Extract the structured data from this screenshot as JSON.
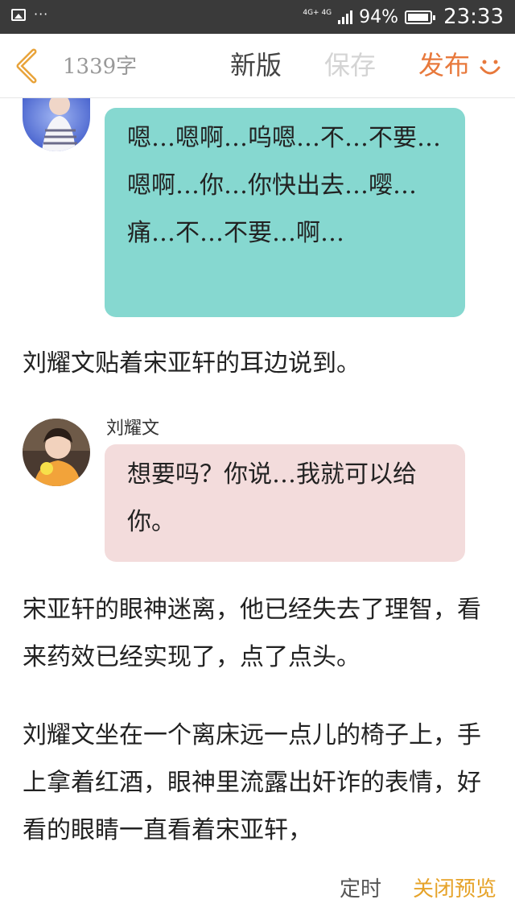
{
  "status_bar": {
    "network": "4G+ 4G",
    "battery": "94%",
    "time": "23:33"
  },
  "toolbar": {
    "word_count": "1339字",
    "new_label": "新版",
    "save_label": "保存",
    "publish_label": "发布"
  },
  "chat": [
    {
      "speaker": "",
      "bubble_color": "#86d8d0",
      "text": "嗯…嗯啊…呜嗯…不…不要…嗯啊…你…你快出去…嘤…痛…不…不要…啊…"
    },
    {
      "speaker": "刘耀文",
      "bubble_color": "#f3dcdc",
      "text": "想要吗？你说…我就可以给你。"
    }
  ],
  "paragraphs": [
    "刘耀文贴着宋亚轩的耳边说到。",
    "宋亚轩的眼神迷离，他已经失去了理智，看来药效已经实现了，点了点头。",
    "刘耀文坐在一个离床远一点儿的椅子上，手上拿着红酒，眼神里流露出奸诈的表情，好看的眼睛一直看着宋亚轩，"
  ],
  "bottom_bar": {
    "timer_label": "定时",
    "close_preview_label": "关闭预览"
  },
  "colors": {
    "status_bar": "#3a3a3a",
    "publish": "#e8793c",
    "close_preview": "#e6a329",
    "save_disabled": "#d4d4d4"
  },
  "icons": {
    "back": "chevron-left-icon",
    "smile": "smile-icon"
  }
}
